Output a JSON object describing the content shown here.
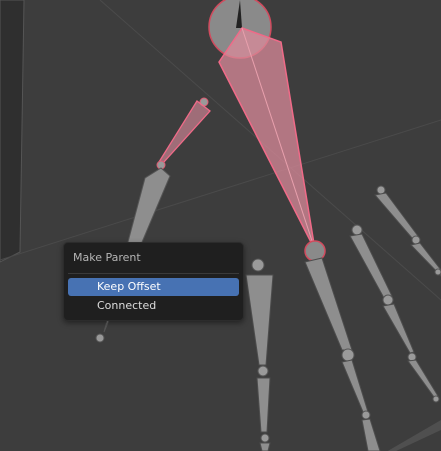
{
  "menu": {
    "title": "Make Parent",
    "items": [
      {
        "label": "Keep Offset",
        "active": true
      },
      {
        "label": "Connected",
        "active": false
      }
    ]
  },
  "colors": {
    "viewport_bg": "#3d3d3d",
    "bone_gray": "#8e8e8e",
    "bone_selected_fill": "#d98a9a",
    "bone_selected_outline": "#f06a88",
    "menu_bg": "#1f1f1f",
    "menu_highlight": "#4772b3"
  }
}
